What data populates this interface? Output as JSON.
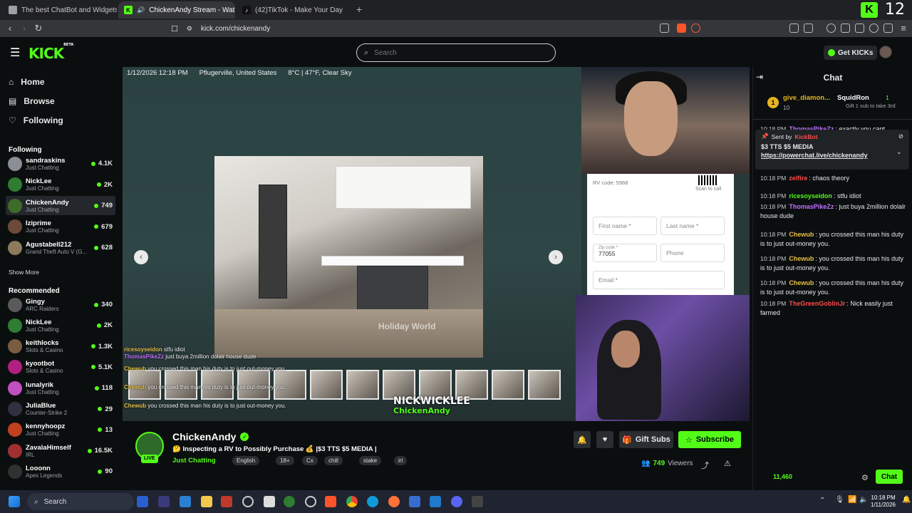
{
  "browser": {
    "tabs": [
      {
        "title": "The best ChatBot and Widgets for Ki",
        "favicon_color": "#9aa0a6"
      },
      {
        "title": "ChickenAndy Stream - Watch",
        "favicon_color": "#53fc18",
        "active": true
      },
      {
        "title": "(42)TikTok - Make Your Day",
        "favicon_color": "#111111"
      }
    ],
    "new_tab": "+",
    "url": "kick.com/chickenandy",
    "corner_badge": "12"
  },
  "header": {
    "logo": "KICK",
    "logo_sup": "BETA",
    "search_placeholder": "Search",
    "get_kicks": "Get KICKs"
  },
  "sidebar": {
    "nav": [
      {
        "label": "Home",
        "icon": "home-icon"
      },
      {
        "label": "Browse",
        "icon": "browse-icon"
      },
      {
        "label": "Following",
        "icon": "heart-icon"
      }
    ],
    "following_heading": "Following",
    "following": [
      {
        "name": "sandraskins",
        "category": "Just Chatting",
        "viewers": "4.1K",
        "color": "#8a8f96"
      },
      {
        "name": "NickLee",
        "category": "Just Chatting",
        "viewers": "2K",
        "color": "#2e7d32"
      },
      {
        "name": "ChickenAndy",
        "category": "Just Chatting",
        "viewers": "749",
        "color": "#3d6b2a"
      },
      {
        "name": "Iziprime",
        "category": "Just Chatting",
        "viewers": "679",
        "color": "#6b4a3a"
      },
      {
        "name": "Agustabell212",
        "category": "Grand Theft Auto V (G...",
        "viewers": "628",
        "color": "#8c7a5c"
      }
    ],
    "show_more": "Show More",
    "recommended_heading": "Recommended",
    "recommended": [
      {
        "name": "Gingy",
        "category": "ARC Raiders",
        "viewers": "340",
        "color": "#5a5a5a"
      },
      {
        "name": "NickLee",
        "category": "Just Chatting",
        "viewers": "2K",
        "color": "#2e7d32"
      },
      {
        "name": "keithlocks",
        "category": "Slots & Casino",
        "viewers": "1.3K",
        "color": "#7a5c40"
      },
      {
        "name": "kyootbot",
        "category": "Slots & Casino",
        "viewers": "5.1K",
        "color": "#b02080"
      },
      {
        "name": "lunalyrik",
        "category": "Just Chatting",
        "viewers": "118",
        "color": "#c050c0"
      },
      {
        "name": "JuliaBlue",
        "category": "Counter-Strike 2",
        "viewers": "29",
        "color": "#303040"
      },
      {
        "name": "kennyhoopz",
        "category": "Just Chatting",
        "viewers": "13",
        "color": "#c04020"
      },
      {
        "name": "ZavalaHimself",
        "category": "IRL",
        "viewers": "16.5K",
        "color": "#a03030"
      },
      {
        "name": "Looonn",
        "category": "Apex Legends",
        "viewers": "90",
        "color": "#303030"
      }
    ]
  },
  "video": {
    "datetime": "1/12/2026 12:18 PM",
    "location": "Pflugerville, United States",
    "weather": "8°C | 47°F, Clear Sky",
    "rv_code": "RV code: 5968",
    "scan_to_call": "Scan to call",
    "form": {
      "first_name": "First name *",
      "last_name": "Last name *",
      "zip_label": "Zip code *",
      "zip_value": "77055",
      "phone": "Phone",
      "email": "Email *"
    },
    "overlay_chat": [
      {
        "user": "ricesoyseidon",
        "text": "stfu idiot"
      },
      {
        "user": "ThomasPikeZz",
        "text": "just buya 2million dolalr house dude"
      },
      {
        "user": "Chewub",
        "text": "you crossed this man his duty is to just out-money you."
      },
      {
        "user": "Chewub",
        "text": "you crossed this man his duty is to just out-money you."
      },
      {
        "user": "Chewub",
        "text": "you crossed this man his duty is to just out-money you."
      }
    ],
    "watermark": "NICKWICKLEE",
    "watermark_sub": "ChickenAndy",
    "brand_text": "Holiday World"
  },
  "stream": {
    "name": "ChickenAndy",
    "title": "🤔 Inspecting a RV to Possibly Purchase 💰 |$3 TTS $5 MEDIA |",
    "category": "Just Chatting",
    "tags": [
      "English",
      "18+",
      "Cx",
      "chill",
      "stake",
      "irl"
    ],
    "live": "LIVE",
    "gift_subs": "Gift Subs",
    "subscribe": "Subscribe",
    "viewers": "749",
    "viewers_label": "Viewers"
  },
  "chat": {
    "title": "Chat",
    "top_gifter": {
      "name": "give_diamon...",
      "count": "10",
      "rank": "1"
    },
    "top_gifter2": {
      "name": "SquidRon",
      "rank": "1",
      "note": "Gift 1 sub to take 3rd"
    },
    "pinned": {
      "sent_by": "Sent by",
      "sender": "KickBot",
      "text": "$3 TTS $5 MEDIA",
      "link": "https://powerchat.live/chickenandy"
    },
    "partial_top": {
      "time": "10:18 PM",
      "user": "ThomasPikeZz",
      "text": "exactly you cant"
    },
    "messages": [
      {
        "time": "10:18 PM",
        "user": "zelfire",
        "color": "#ff4a4a",
        "text": "chaos theory"
      },
      {
        "time": "10:18 PM",
        "user": "ricesoyseidon",
        "color": "#53fc18",
        "text": "stfu idiot"
      },
      {
        "time": "10:18 PM",
        "user": "ThomasPikeZz",
        "color": "#c070ff",
        "text": "just buya 2million dolalr house dude"
      },
      {
        "time": "10:18 PM",
        "user": "Chewub",
        "color": "#e6c04a",
        "text": "you crossed this man his duty is to just out-money you."
      },
      {
        "time": "10:18 PM",
        "user": "Chewub",
        "color": "#e6c04a",
        "text": "you crossed this man his duty is to just out-money you."
      },
      {
        "time": "10:18 PM",
        "user": "Chewub",
        "color": "#e6c04a",
        "text": "you crossed this man his duty is to just out-money you."
      },
      {
        "time": "10:18 PM",
        "user": "TheGreenGoblinJr",
        "color": "#ff4a4a",
        "text": "Nick easily just farmed"
      }
    ],
    "bottom_count": "11,460",
    "chat_button": "Chat"
  },
  "taskbar": {
    "search": "Search",
    "time": "10:18 PM",
    "date": "1/11/2026"
  }
}
